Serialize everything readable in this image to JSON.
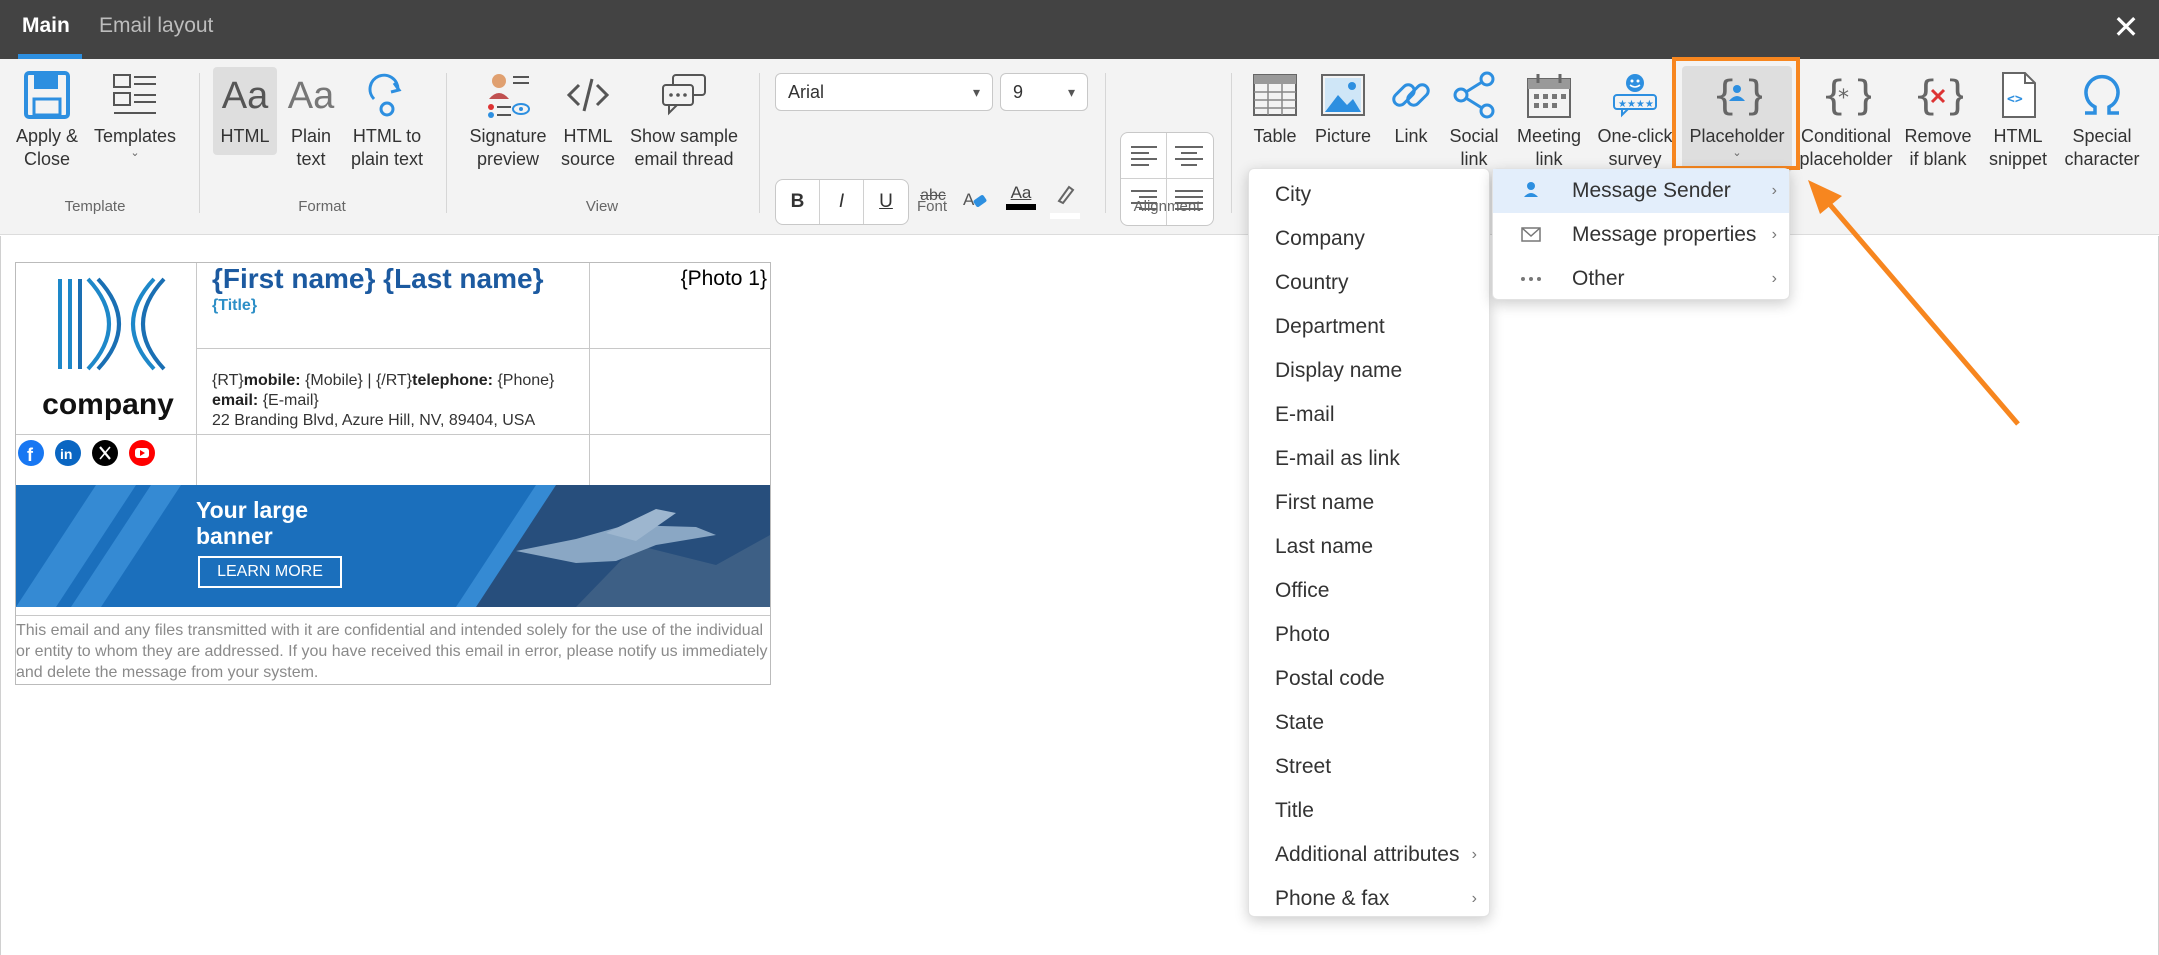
{
  "tabs": [
    {
      "label": "Main",
      "active": true
    },
    {
      "label": "Email layout",
      "active": false
    }
  ],
  "close_icon": "close-icon",
  "ribbon": {
    "template": {
      "group_label": "Template",
      "apply_close": "Apply &\nClose",
      "templates": "Templates"
    },
    "format": {
      "group_label": "Format",
      "html": "HTML",
      "plain_text": "Plain\ntext",
      "html_to_plain": "HTML to\nplain text"
    },
    "view": {
      "group_label": "View",
      "signature_preview": "Signature\npreview",
      "html_source": "HTML\nsource",
      "show_sample": "Show sample\nemail thread"
    },
    "font": {
      "group_label": "Font",
      "family": "Arial",
      "size": "9",
      "bold": "B",
      "italic": "I",
      "underline": "U",
      "strike": "abc",
      "font_color_glyph": "Aa"
    },
    "alignment": {
      "group_label": "Alignment"
    },
    "insert": {
      "table": "Table",
      "picture": "Picture",
      "link": "Link",
      "social_link": "Social\nlink",
      "meeting_link": "Meeting\nlink",
      "one_click_survey": "One-click\nsurvey",
      "placeholder": "Placeholder",
      "conditional_placeholder": "Conditional\nplaceholder",
      "remove_if_blank": "Remove\nif blank",
      "html_snippet": "HTML\nsnippet",
      "special_character": "Special\ncharacter"
    }
  },
  "signature": {
    "logo_text": "company",
    "name_line": "{First name} {Last name}",
    "title": "{Title}",
    "photo": "{Photo 1}",
    "contact_line1_a": "{RT}",
    "contact_line1_b": "mobile:",
    "contact_line1_c": " {Mobile}  |  {/RT}",
    "contact_line1_d": "telephone:",
    "contact_line1_e": " {Phone}",
    "email_label": "email:",
    "email_value": " {E-mail}",
    "address": "22 Branding Blvd, Azure Hill, NV, 89404, USA",
    "banner_title_1": "Your large",
    "banner_title_2": "banner",
    "banner_button": "LEARN MORE",
    "disclaimer": "This email and any files transmitted with it are confidential and intended solely for the use of the individual or entity to whom they are addressed. If you have received this email in error, please notify us immediately and delete the message from your system.",
    "social_icons": [
      "facebook-icon",
      "linkedin-icon",
      "x-icon",
      "youtube-icon"
    ]
  },
  "placeholder_menu": {
    "items": [
      {
        "label": "City",
        "submenu": false
      },
      {
        "label": "Company",
        "submenu": false
      },
      {
        "label": "Country",
        "submenu": false
      },
      {
        "label": "Department",
        "submenu": false
      },
      {
        "label": "Display name",
        "submenu": false
      },
      {
        "label": "E-mail",
        "submenu": false
      },
      {
        "label": "E-mail as link",
        "submenu": false
      },
      {
        "label": "First name",
        "submenu": false
      },
      {
        "label": "Last name",
        "submenu": false
      },
      {
        "label": "Office",
        "submenu": false
      },
      {
        "label": "Photo",
        "submenu": false
      },
      {
        "label": "Postal code",
        "submenu": false
      },
      {
        "label": "State",
        "submenu": false
      },
      {
        "label": "Street",
        "submenu": false
      },
      {
        "label": "Title",
        "submenu": false
      },
      {
        "label": "Additional attributes",
        "submenu": true
      },
      {
        "label": "Phone & fax",
        "submenu": true
      }
    ]
  },
  "category_menu": {
    "items": [
      {
        "label": "Message Sender",
        "icon": "person-icon",
        "highlighted": true
      },
      {
        "label": "Message properties",
        "icon": "envelope-icon",
        "highlighted": false
      },
      {
        "label": "Other",
        "icon": "more-icon",
        "highlighted": false
      }
    ]
  },
  "colors": {
    "titlebar": "#434343",
    "accent": "#2d8fe0",
    "highlight_orange": "#f7861f",
    "name_blue": "#1c5aa0",
    "banner_blue": "#1b6fbc"
  }
}
